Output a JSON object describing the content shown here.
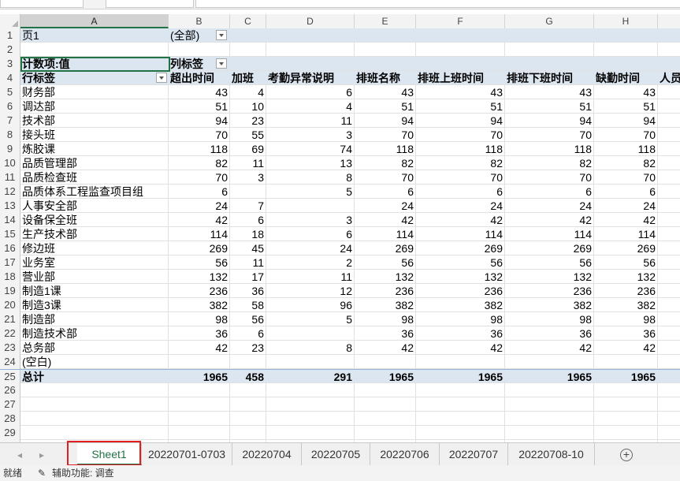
{
  "columns": [
    "A",
    "B",
    "C",
    "D",
    "E",
    "F",
    "G",
    "H"
  ],
  "page_field": {
    "label": "页1",
    "value": "(全部)"
  },
  "pivot": {
    "count_label": "计数项:值",
    "col_label_header": "列标签",
    "row_label_header": "行标签",
    "headers": [
      "超出时间",
      "加班",
      "考勤异常说明",
      "排班名称",
      "排班上班时间",
      "排班下班时间",
      "缺勤时间",
      "人员"
    ],
    "rows": [
      [
        "财务部",
        "43",
        "4",
        "6",
        "43",
        "43",
        "43",
        "43"
      ],
      [
        "调达部",
        "51",
        "10",
        "4",
        "51",
        "51",
        "51",
        "51"
      ],
      [
        "技术部",
        "94",
        "23",
        "11",
        "94",
        "94",
        "94",
        "94"
      ],
      [
        "接头班",
        "70",
        "55",
        "3",
        "70",
        "70",
        "70",
        "70"
      ],
      [
        "炼胶课",
        "118",
        "69",
        "74",
        "118",
        "118",
        "118",
        "118"
      ],
      [
        "品质管理部",
        "82",
        "11",
        "13",
        "82",
        "82",
        "82",
        "82"
      ],
      [
        "品质检查班",
        "70",
        "3",
        "8",
        "70",
        "70",
        "70",
        "70"
      ],
      [
        "品质体系工程监查项目组",
        "6",
        "",
        "5",
        "6",
        "6",
        "6",
        "6"
      ],
      [
        "人事安全部",
        "24",
        "7",
        "",
        "24",
        "24",
        "24",
        "24"
      ],
      [
        "设备保全班",
        "42",
        "6",
        "3",
        "42",
        "42",
        "42",
        "42"
      ],
      [
        "生产技术部",
        "114",
        "18",
        "6",
        "114",
        "114",
        "114",
        "114"
      ],
      [
        "修边班",
        "269",
        "45",
        "24",
        "269",
        "269",
        "269",
        "269"
      ],
      [
        "业务室",
        "56",
        "11",
        "2",
        "56",
        "56",
        "56",
        "56"
      ],
      [
        "营业部",
        "132",
        "17",
        "11",
        "132",
        "132",
        "132",
        "132"
      ],
      [
        "制造1课",
        "236",
        "36",
        "12",
        "236",
        "236",
        "236",
        "236"
      ],
      [
        "制造3课",
        "382",
        "58",
        "96",
        "382",
        "382",
        "382",
        "382"
      ],
      [
        "制造部",
        "98",
        "56",
        "5",
        "98",
        "98",
        "98",
        "98"
      ],
      [
        "制造技术部",
        "36",
        "6",
        "",
        "36",
        "36",
        "36",
        "36"
      ],
      [
        "总务部",
        "42",
        "23",
        "8",
        "42",
        "42",
        "42",
        "42"
      ],
      [
        "(空白)",
        "",
        "",
        "",
        "",
        "",
        "",
        ""
      ]
    ],
    "total": [
      "总计",
      "1965",
      "458",
      "291",
      "1965",
      "1965",
      "1965",
      "1965"
    ]
  },
  "tabs": [
    "Sheet1",
    "20220701-0703",
    "20220704",
    "20220705",
    "20220706",
    "20220707",
    "20220708-10"
  ],
  "status": {
    "ready": "就绪",
    "accessibility": "辅助功能: 调查"
  }
}
